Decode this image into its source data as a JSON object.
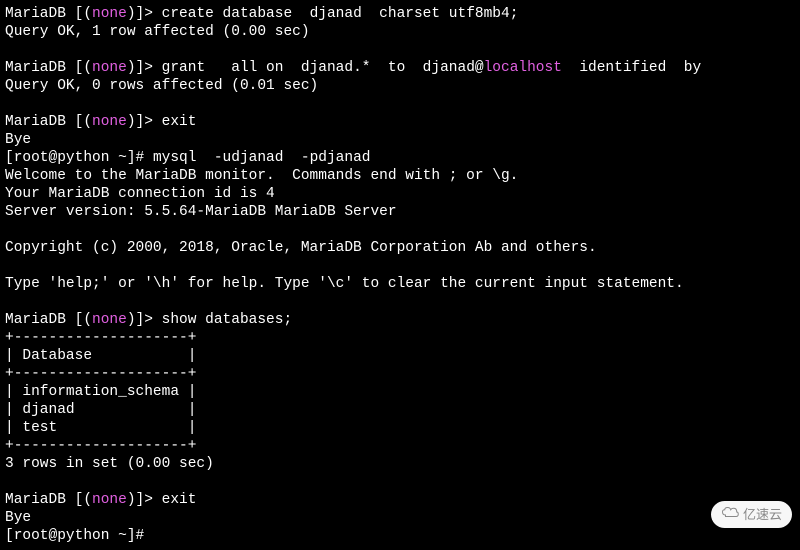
{
  "prompt": {
    "mariadb_pre": "MariaDB [(",
    "mariadb_none": "none",
    "mariadb_post": ")]> "
  },
  "shell_prompt": "[root@python ~]# ",
  "cmd1": "create database  djanad  charset utf8mb4;",
  "resp1": "Query OK, 1 row affected (0.00 sec)",
  "cmd2_a": "grant   all on  djanad.*  to  djanad@",
  "cmd2_host": "localhost",
  "cmd2_b": "  identified  by",
  "resp2": "Query OK, 0 rows affected (0.01 sec)",
  "cmd3": "exit",
  "bye": "Bye",
  "shell_cmd": "mysql  -udjanad  -pdjanad",
  "welcome1": "Welcome to the MariaDB monitor.  Commands end with ; or \\g.",
  "welcome2": "Your MariaDB connection id is 4",
  "welcome3": "Server version: 5.5.64-MariaDB MariaDB Server",
  "copyright": "Copyright (c) 2000, 2018, Oracle, MariaDB Corporation Ab and others.",
  "help": "Type 'help;' or '\\h' for help. Type '\\c' to clear the current input statement.",
  "cmd4": "show databases;",
  "tbl_border": "+--------------------+",
  "tbl_header": "| Database           |",
  "tbl_row1": "| information_schema |",
  "tbl_row2": "| djanad             |",
  "tbl_row3": "| test               |",
  "tbl_footer": "3 rows in set (0.00 sec)",
  "cmd5": "exit",
  "bye2": "Bye",
  "shell2": "[root@python ~]#",
  "watermark": "亿速云"
}
